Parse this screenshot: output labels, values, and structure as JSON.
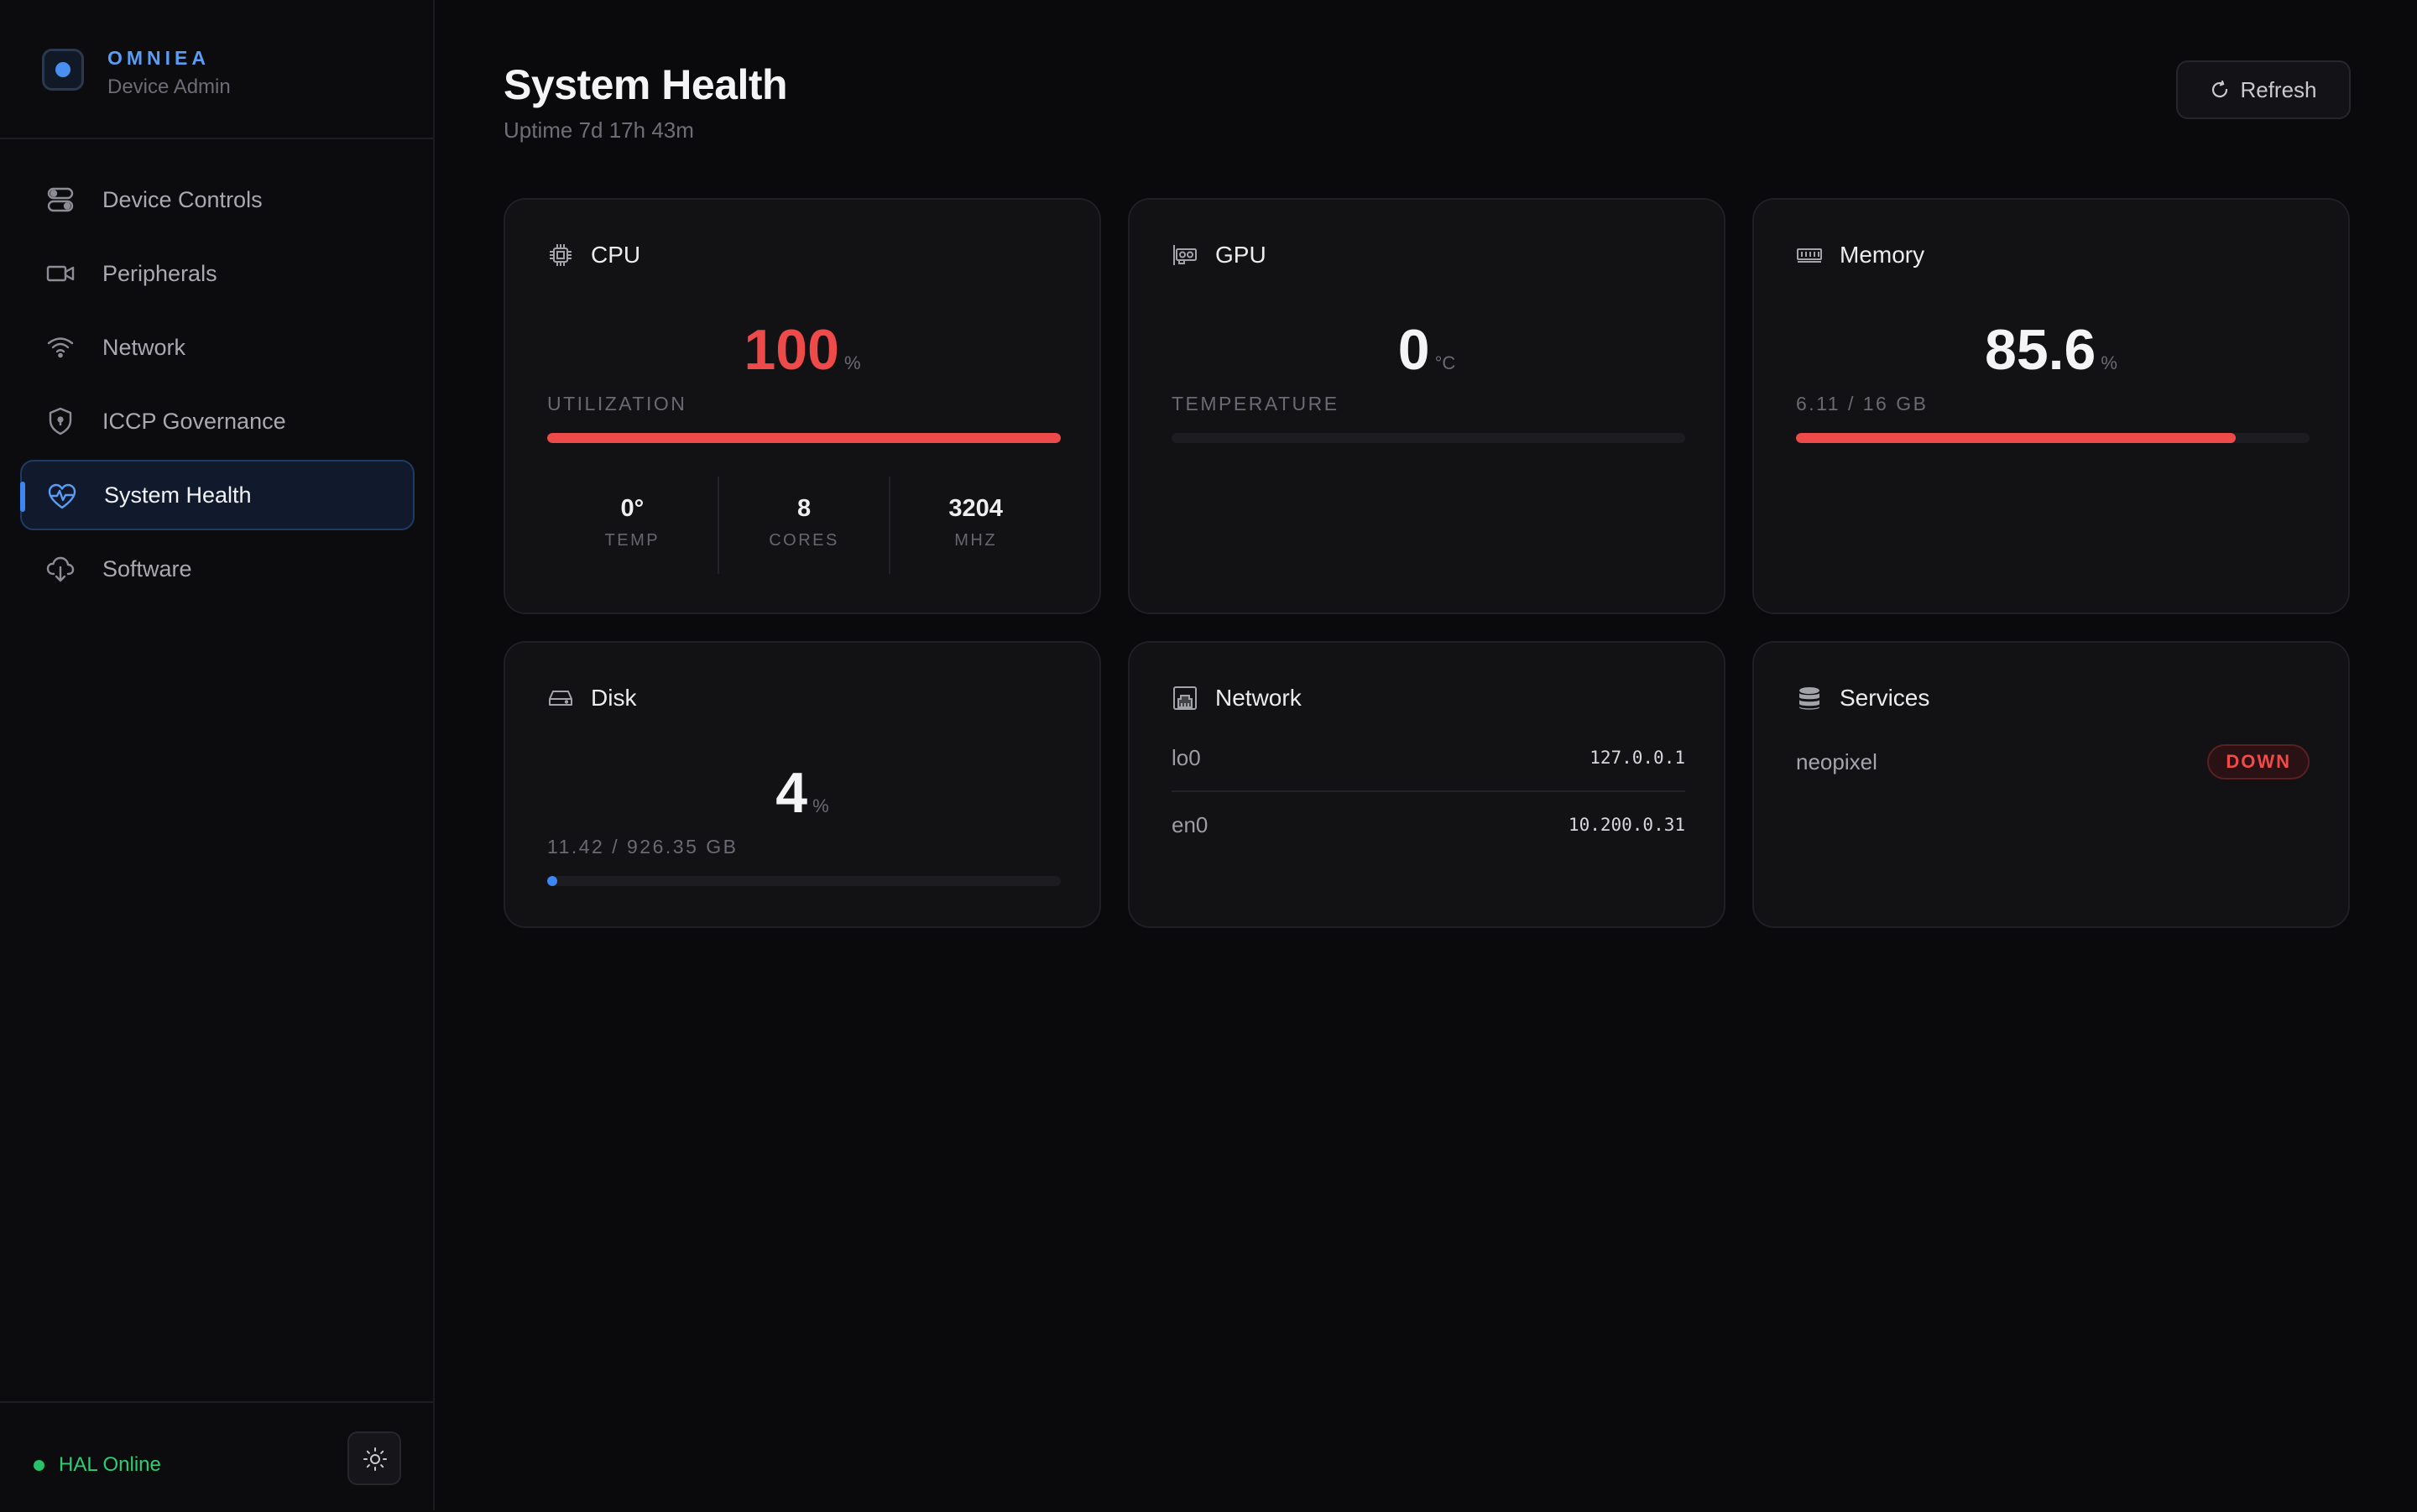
{
  "brand": {
    "name": "OMNIEA",
    "subtitle": "Device Admin"
  },
  "nav": {
    "items": [
      {
        "label": "Device Controls",
        "icon": "toggles-icon",
        "active": false
      },
      {
        "label": "Peripherals",
        "icon": "camera-icon",
        "active": false
      },
      {
        "label": "Network",
        "icon": "wifi-icon",
        "active": false
      },
      {
        "label": "ICCP Governance",
        "icon": "shield-icon",
        "active": false
      },
      {
        "label": "System Health",
        "icon": "heart-pulse-icon",
        "active": true
      },
      {
        "label": "Software",
        "icon": "cloud-download-icon",
        "active": false
      }
    ]
  },
  "footer": {
    "status": "HAL Online",
    "status_color": "#2fcb73",
    "theme_icon": "sun-icon"
  },
  "header": {
    "title": "System Health",
    "uptime": "Uptime 7d 17h 43m",
    "refresh_label": "Refresh"
  },
  "cpu": {
    "title": "CPU",
    "value": "100",
    "unit": "%",
    "caption": "UTILIZATION",
    "utilization_pct": 100,
    "stats": [
      {
        "value": "0°",
        "label": "TEMP"
      },
      {
        "value": "8",
        "label": "CORES"
      },
      {
        "value": "3204",
        "label": "MHZ"
      }
    ]
  },
  "gpu": {
    "title": "GPU",
    "value": "0",
    "unit": "°C",
    "caption": "TEMPERATURE",
    "level_pct": 0
  },
  "memory": {
    "title": "Memory",
    "value": "85.6",
    "unit": "%",
    "caption": "6.11 / 16 GB",
    "usage_pct": 85.6
  },
  "disk": {
    "title": "Disk",
    "value": "4",
    "unit": "%",
    "caption": "11.42 / 926.35 GB",
    "usage_pct": 2
  },
  "network": {
    "title": "Network",
    "interfaces": [
      {
        "name": "lo0",
        "ip": "127.0.0.1"
      },
      {
        "name": "en0",
        "ip": "10.200.0.31"
      }
    ]
  },
  "services": {
    "title": "Services",
    "items": [
      {
        "name": "neopixel",
        "status": "DOWN"
      }
    ]
  },
  "colors": {
    "accent": "#3e86f2",
    "danger": "#ef4a4a",
    "background": "#0a0a0c"
  }
}
